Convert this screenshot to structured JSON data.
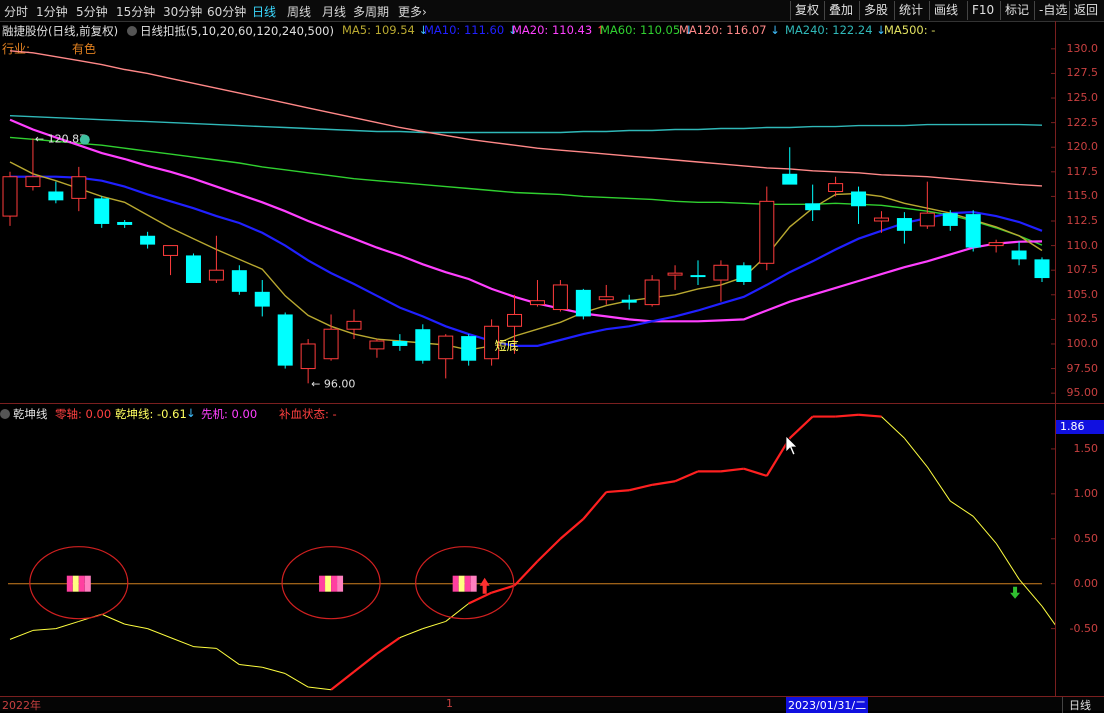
{
  "toolbar": {
    "timeframes": [
      "分时",
      "1分钟",
      "5分钟",
      "15分钟",
      "30分钟",
      "60分钟",
      "日线",
      "周线",
      "月线",
      "多周期",
      "更多"
    ],
    "more_arrow": "›",
    "active_timeframe": "日线",
    "right_buttons": [
      "复权",
      "叠加",
      "多股",
      "统计",
      "画线",
      "F10",
      "标记",
      "-自选",
      "返回"
    ]
  },
  "info": {
    "stock_label": "融捷股份(日线,前复权)",
    "main_indicator": "日线扣抵(5,10,20,60,120,240,500)",
    "industry_label": "行业:",
    "industry_value": "有色",
    "ma": [
      {
        "text": "MA5: 109.54",
        "arrow": "↓",
        "color": "#b8a830"
      },
      {
        "text": "MA10: 111.60",
        "arrow": "↓",
        "color": "#2020ff"
      },
      {
        "text": "MA20: 110.43",
        "arrow": "↑",
        "color": "#ff40ff"
      },
      {
        "text": "MA60: 110.05",
        "arrow": "↓",
        "color": "#30d030"
      },
      {
        "text": "MA120: 116.07",
        "arrow": "↓",
        "color": "#ff8888"
      },
      {
        "text": "MA240: 122.24",
        "arrow": "↓",
        "color": "#30b8b8"
      },
      {
        "text": "MA500: -",
        "arrow": "",
        "color": "#e0e060"
      }
    ]
  },
  "indicator": {
    "name": "乾坤线",
    "zero_axis": "零轴: 0.00",
    "value": "乾坤线: -0.61",
    "value_arrow": "↓",
    "early": "先机: 0.00",
    "status": "补血状态: -"
  },
  "annotations": {
    "high": "120.87",
    "low": "96.00",
    "short_bottom": "短底",
    "current_value_box": "1.86"
  },
  "price_axis": [
    "130.0",
    "127.5",
    "125.0",
    "122.5",
    "120.0",
    "117.5",
    "115.0",
    "112.5",
    "110.0",
    "107.5",
    "105.0",
    "102.5",
    "100.0",
    "97.50",
    "95.00"
  ],
  "indicator_axis": [
    "1.50",
    "1.00",
    "0.50",
    "0.00",
    "-0.50"
  ],
  "bottom": {
    "left_label": "2022年",
    "mid_label": "1",
    "date_box": "2023/01/31/二",
    "right_label": "日线"
  },
  "colors": {
    "up": "#ff3c3c",
    "down": "#00ffff",
    "ma5": "#b8a830",
    "ma10": "#2020ff",
    "ma20": "#ff40ff",
    "ma60": "#30d030",
    "ma120": "#ff8888",
    "ma240": "#30b8b8",
    "indicator_line": "#ffff40",
    "indicator_up": "#ff2020"
  },
  "chart_data": {
    "type": "candlestick",
    "candles": [
      {
        "o": 113,
        "h": 117.5,
        "l": 112,
        "c": 117
      },
      {
        "o": 116,
        "h": 120.9,
        "l": 115.6,
        "c": 117
      },
      {
        "o": 115.5,
        "h": 116.5,
        "l": 114.3,
        "c": 114.6
      },
      {
        "o": 114.8,
        "h": 118,
        "l": 113.5,
        "c": 117
      },
      {
        "o": 114.8,
        "h": 115,
        "l": 111.8,
        "c": 112.2
      },
      {
        "o": 112.4,
        "h": 112.6,
        "l": 111.8,
        "c": 112.1
      },
      {
        "o": 111,
        "h": 111.4,
        "l": 109.7,
        "c": 110.1
      },
      {
        "o": 109,
        "h": 110,
        "l": 107,
        "c": 110
      },
      {
        "o": 109,
        "h": 109.2,
        "l": 106.2,
        "c": 106.2
      },
      {
        "o": 106.5,
        "h": 111,
        "l": 106.2,
        "c": 107.5
      },
      {
        "o": 107.5,
        "h": 108,
        "l": 105,
        "c": 105.3
      },
      {
        "o": 105.3,
        "h": 106.5,
        "l": 102.8,
        "c": 103.8
      },
      {
        "o": 103,
        "h": 103.2,
        "l": 97.5,
        "c": 97.8
      },
      {
        "o": 97.5,
        "h": 100.5,
        "l": 96,
        "c": 100
      },
      {
        "o": 98.5,
        "h": 103,
        "l": 98.3,
        "c": 101.5
      },
      {
        "o": 101.5,
        "h": 103.5,
        "l": 100.5,
        "c": 102.3
      },
      {
        "o": 99.5,
        "h": 100.5,
        "l": 98.6,
        "c": 100.3
      },
      {
        "o": 100.3,
        "h": 101,
        "l": 99.3,
        "c": 99.8
      },
      {
        "o": 101.5,
        "h": 102,
        "l": 98,
        "c": 98.3
      },
      {
        "o": 98.5,
        "h": 101,
        "l": 96.5,
        "c": 100.8
      },
      {
        "o": 100.8,
        "h": 101,
        "l": 97.8,
        "c": 98.3
      },
      {
        "o": 98.5,
        "h": 102.5,
        "l": 97.8,
        "c": 101.8
      },
      {
        "o": 101.8,
        "h": 105,
        "l": 99,
        "c": 103
      },
      {
        "o": 104,
        "h": 106.5,
        "l": 103.8,
        "c": 104.4
      },
      {
        "o": 103.5,
        "h": 106.5,
        "l": 103.3,
        "c": 106
      },
      {
        "o": 105.5,
        "h": 105.6,
        "l": 102.5,
        "c": 102.8
      },
      {
        "o": 104.5,
        "h": 106,
        "l": 104,
        "c": 104.8
      },
      {
        "o": 104.5,
        "h": 105,
        "l": 103.5,
        "c": 104.2
      },
      {
        "o": 104,
        "h": 107,
        "l": 103.8,
        "c": 106.5
      },
      {
        "o": 107,
        "h": 108,
        "l": 105.5,
        "c": 107.2
      },
      {
        "o": 107,
        "h": 108.5,
        "l": 106,
        "c": 106.8
      },
      {
        "o": 106.5,
        "h": 108.5,
        "l": 104.3,
        "c": 108
      },
      {
        "o": 108,
        "h": 108.3,
        "l": 106,
        "c": 106.3
      },
      {
        "o": 108.2,
        "h": 116,
        "l": 107.5,
        "c": 114.5
      },
      {
        "o": 117.3,
        "h": 120,
        "l": 116.3,
        "c": 116.2
      },
      {
        "o": 114.3,
        "h": 116.2,
        "l": 112.5,
        "c": 113.6
      },
      {
        "o": 115.5,
        "h": 117,
        "l": 115,
        "c": 116.3
      },
      {
        "o": 115.5,
        "h": 116,
        "l": 112.2,
        "c": 114
      },
      {
        "o": 112.5,
        "h": 113.5,
        "l": 111.3,
        "c": 112.8
      },
      {
        "o": 112.8,
        "h": 113.4,
        "l": 110.2,
        "c": 111.5
      },
      {
        "o": 112,
        "h": 116.5,
        "l": 111.7,
        "c": 113.3
      },
      {
        "o": 113.3,
        "h": 113.6,
        "l": 111.5,
        "c": 112
      },
      {
        "o": 113.2,
        "h": 113.6,
        "l": 109.4,
        "c": 109.8
      },
      {
        "o": 110,
        "h": 110.6,
        "l": 109.3,
        "c": 110.3
      },
      {
        "o": 109.5,
        "h": 110.4,
        "l": 108,
        "c": 108.6
      },
      {
        "o": 108.6,
        "h": 108.8,
        "l": 106.3,
        "c": 106.7
      }
    ],
    "ma5": [
      118.5,
      117.3,
      116.6,
      115.8,
      115,
      114.4,
      113.1,
      111.8,
      110.7,
      109.6,
      108.6,
      107.6,
      104.9,
      102.9,
      101.8,
      101,
      100.5,
      100.3,
      100.1,
      99.9,
      99.4,
      99.8,
      100.8,
      101.5,
      102.2,
      103.2,
      103.9,
      104.4,
      104.7,
      105,
      105.6,
      106,
      106.8,
      109,
      111.9,
      113.8,
      115.2,
      115.3,
      115,
      114.3,
      113.8,
      113.3,
      112.6,
      111.9,
      111,
      109.5
    ],
    "ma10": [
      117,
      117,
      117,
      116.9,
      116.6,
      116,
      115.2,
      114.5,
      113.8,
      113,
      112.3,
      111.3,
      110,
      108.5,
      107.2,
      106.1,
      104.9,
      103.7,
      102.8,
      101.8,
      101,
      100.3,
      99.8,
      99.8,
      100.4,
      101,
      101.5,
      101.8,
      102.3,
      102.8,
      103.4,
      104.1,
      104.8,
      106,
      107.3,
      108.4,
      109.6,
      110.7,
      111.5,
      112.3,
      112.8,
      113.3,
      113.4,
      113,
      112.4,
      111.5
    ],
    "ma20": [
      122.8,
      121.8,
      121,
      120.2,
      119.4,
      118.8,
      118.1,
      117.5,
      116.8,
      116,
      115.2,
      114.4,
      113.5,
      112.5,
      111.6,
      110.7,
      109.8,
      109,
      108.1,
      107.3,
      106.6,
      105.6,
      104.8,
      104.1,
      103.6,
      103.1,
      102.8,
      102.5,
      102.3,
      102.3,
      102.3,
      102.4,
      102.5,
      103.4,
      104.3,
      105,
      105.7,
      106.4,
      107.1,
      107.8,
      108.4,
      109.1,
      109.8,
      110.2,
      110.4,
      110.43
    ],
    "ma60": [
      121,
      120.8,
      120.6,
      120.4,
      120.2,
      119.9,
      119.6,
      119.3,
      119,
      118.7,
      118.4,
      118,
      117.7,
      117.4,
      117.1,
      116.8,
      116.6,
      116.4,
      116.2,
      116,
      115.8,
      115.6,
      115.4,
      115.3,
      115.2,
      115,
      114.9,
      114.8,
      114.7,
      114.5,
      114.4,
      114.4,
      114.3,
      114.2,
      114.2,
      114.2,
      114.3,
      114.2,
      114.1,
      113.8,
      113.5,
      113.1,
      112.5,
      111.8,
      111,
      110.05
    ],
    "ma120": [
      129.8,
      129.6,
      129.2,
      128.8,
      128.4,
      127.9,
      127.5,
      127,
      126.5,
      126,
      125.5,
      125,
      124.5,
      124,
      123.5,
      123,
      122.5,
      122,
      121.6,
      121.2,
      120.8,
      120.5,
      120.2,
      119.9,
      119.7,
      119.5,
      119.3,
      119.1,
      118.9,
      118.7,
      118.5,
      118.3,
      118.1,
      117.9,
      117.8,
      117.6,
      117.5,
      117.4,
      117.2,
      117.1,
      117,
      116.8,
      116.6,
      116.4,
      116.2,
      116.07
    ],
    "ma240": [
      123.2,
      123.1,
      123,
      122.9,
      122.8,
      122.7,
      122.6,
      122.5,
      122.4,
      122.3,
      122.2,
      122.1,
      122,
      121.9,
      121.8,
      121.7,
      121.6,
      121.6,
      121.5,
      121.5,
      121.5,
      121.5,
      121.5,
      121.5,
      121.5,
      121.6,
      121.6,
      121.7,
      121.7,
      121.8,
      121.8,
      121.9,
      121.9,
      122,
      122,
      122.1,
      122.1,
      122.2,
      122.2,
      122.2,
      122.3,
      122.3,
      122.3,
      122.3,
      122.3,
      122.24
    ],
    "indicator": [
      -0.62,
      -0.52,
      -0.5,
      -0.42,
      -0.34,
      -0.45,
      -0.5,
      -0.6,
      -0.7,
      -0.72,
      -0.9,
      -0.93,
      -1.0,
      -1.15,
      -1.18,
      -0.98,
      -0.78,
      -0.6,
      -0.5,
      -0.42,
      -0.22,
      -0.1,
      -0.02,
      0.25,
      0.5,
      0.72,
      1.02,
      1.04,
      1.1,
      1.14,
      1.25,
      1.25,
      1.28,
      1.2,
      1.62,
      1.86,
      1.86,
      1.88,
      1.86,
      1.62,
      1.3,
      0.92,
      0.75,
      0.45,
      0.05,
      -0.25,
      -0.61
    ],
    "indicator_color": [
      "y",
      "y",
      "y",
      "y",
      "y",
      "y",
      "y",
      "y",
      "y",
      "y",
      "y",
      "y",
      "y",
      "y",
      "y",
      "r",
      "r",
      "r",
      "y",
      "y",
      "y",
      "r",
      "r",
      "r",
      "r",
      "r",
      "r",
      "r",
      "r",
      "r",
      "r",
      "r",
      "r",
      "r",
      "r",
      "r",
      "r",
      "r",
      "r",
      "y",
      "y",
      "y",
      "y",
      "y",
      "y",
      "y",
      "y"
    ],
    "y_range": [
      94.0,
      131.0
    ],
    "indicator_range": [
      -1.25,
      2.0
    ]
  }
}
